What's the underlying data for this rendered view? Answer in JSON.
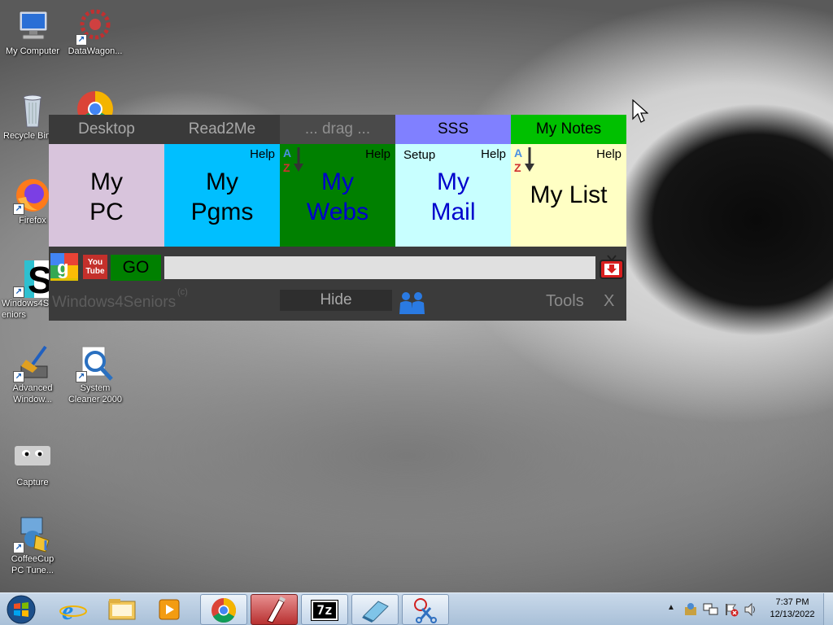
{
  "desktop": {
    "icons": [
      {
        "label": "My Computer",
        "icon": "computer-icon"
      },
      {
        "label": "DataWagon...",
        "icon": "datawagon-icon"
      },
      {
        "label": "Recycle Bin",
        "icon": "recycle-bin-icon"
      },
      {
        "label": "Firefox",
        "icon": "firefox-icon"
      },
      {
        "label": "Windows4Seniors",
        "icon": "windows4seniors-icon"
      },
      {
        "label": "Advanced Window...",
        "icon": "advanced-windows-icon"
      },
      {
        "label": "System Cleaner 2000",
        "icon": "system-cleaner-icon"
      },
      {
        "label": "Capture",
        "icon": "capture-icon"
      },
      {
        "label": "CoffeeCup PC Tune...",
        "icon": "coffeecup-icon"
      }
    ]
  },
  "panel": {
    "tabs": [
      {
        "label": "Desktop",
        "bg": "#3a3a3a",
        "fg": "#a8a8a8"
      },
      {
        "label": "Read2Me",
        "bg": "#3a3a3a",
        "fg": "#a8a8a8"
      },
      {
        "label": "... drag ...",
        "bg": "#4a4a4a",
        "fg": "#8f8f8f"
      },
      {
        "label": "SSS",
        "bg": "#8080ff",
        "fg": "#000000"
      },
      {
        "label": "My Notes",
        "bg": "#00c000",
        "fg": "#000000"
      }
    ],
    "tiles": {
      "pc": {
        "line1": "My",
        "line2": "PC",
        "bg": "#d8c4dc",
        "fg": "#000000"
      },
      "pgms": {
        "line1": "My",
        "line2": "Pgms",
        "help": "Help",
        "bg": "#00bfff",
        "fg": "#000000"
      },
      "webs": {
        "line1": "My",
        "line2": "Webs",
        "help": "Help",
        "bg": "#008000",
        "fg": "#0000cc"
      },
      "mail": {
        "line1": "My",
        "line2": "Mail",
        "setup": "Setup",
        "help": "Help",
        "bg": "#c8ffff",
        "fg": "#0000cc"
      },
      "list": {
        "label": "My List",
        "help": "Help",
        "bg": "#ffffc4",
        "fg": "#000000"
      }
    },
    "search": {
      "go_label": "GO",
      "value": "",
      "youtube_label": "You Tube"
    },
    "bottom": {
      "brand": "Windows4Seniors",
      "copyright": "(c)",
      "hide_label": "Hide",
      "tools_label": "Tools",
      "close_label": "X"
    }
  },
  "taskbar": {
    "time": "7:37 PM",
    "date": "12/13/2022",
    "pinned": [
      "windows-start-icon",
      "internet-explorer-icon",
      "file-explorer-icon",
      "media-player-icon",
      "chrome-icon",
      "paint-app-icon",
      "7zip-icon",
      "notepad-app-icon",
      "snipping-tool-icon"
    ],
    "seven_zip_label": "7z"
  }
}
